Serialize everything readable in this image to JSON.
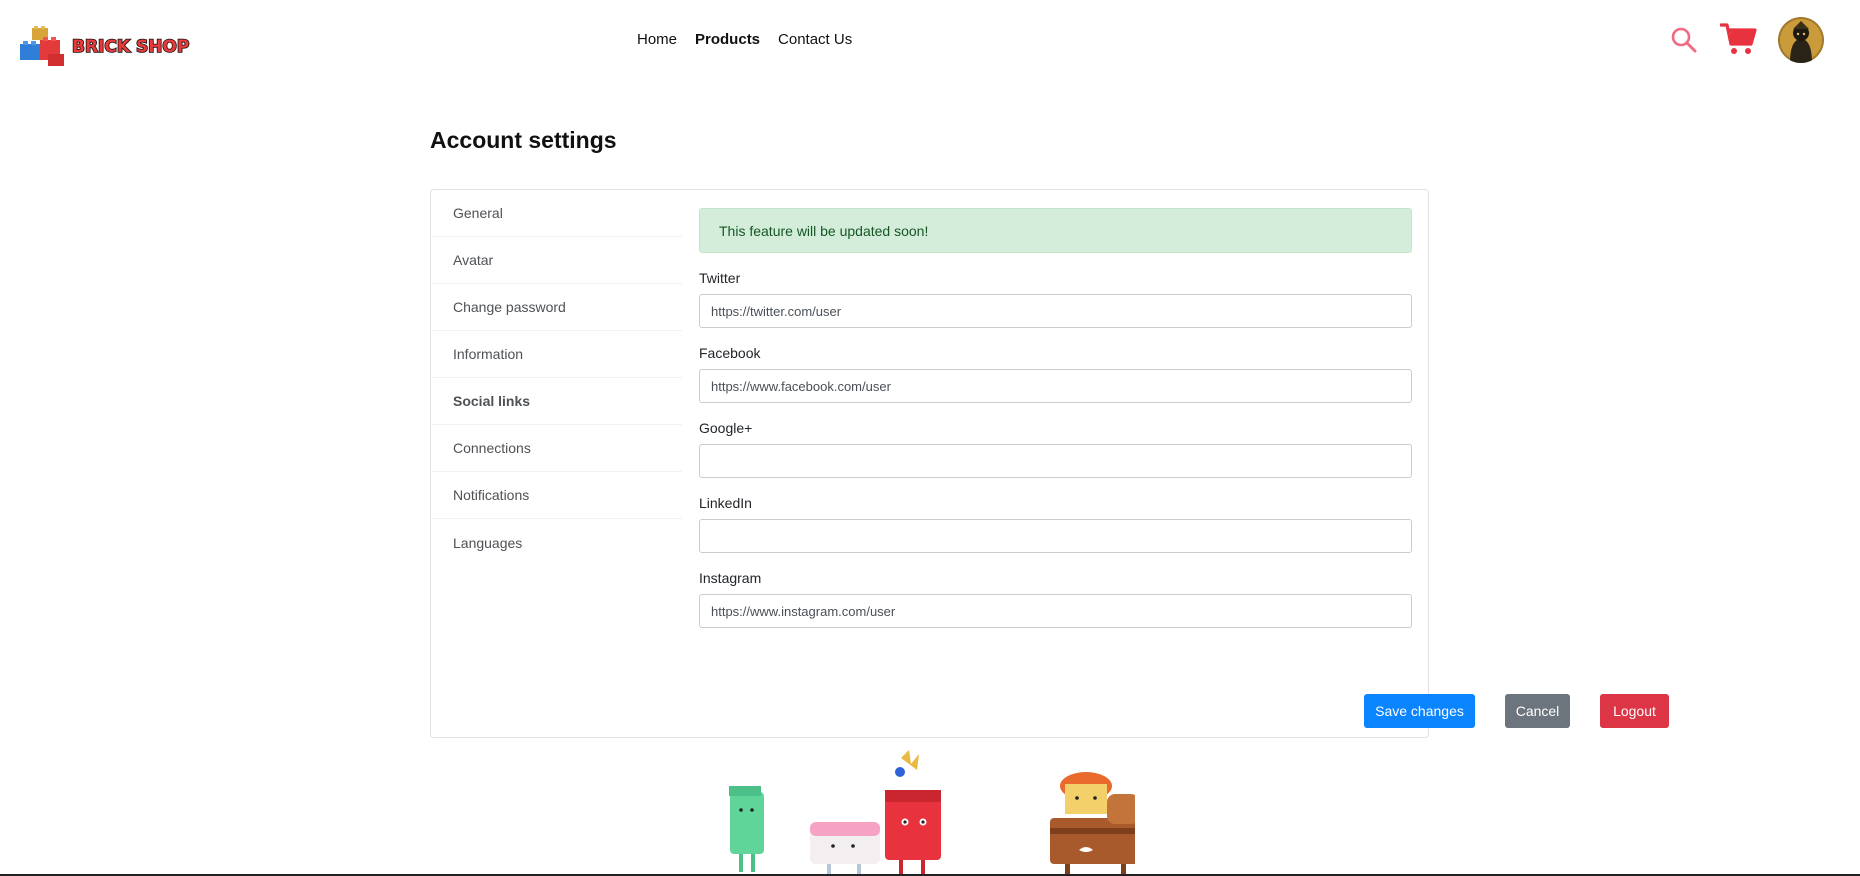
{
  "brand": {
    "name": "BRICK SHOP"
  },
  "nav": {
    "items": [
      {
        "label": "Home",
        "active": false
      },
      {
        "label": "Products",
        "active": true
      },
      {
        "label": "Contact Us",
        "active": false
      }
    ]
  },
  "header_icons": {
    "search": "search-icon",
    "cart": "cart-icon",
    "avatar": "user-avatar"
  },
  "page": {
    "title": "Account settings"
  },
  "sidebar": {
    "items": [
      {
        "label": "General"
      },
      {
        "label": "Avatar"
      },
      {
        "label": "Change password"
      },
      {
        "label": "Information"
      },
      {
        "label": "Social links",
        "active": true
      },
      {
        "label": "Connections"
      },
      {
        "label": "Notifications"
      },
      {
        "label": "Languages"
      }
    ]
  },
  "alert": {
    "text": "This feature will be updated soon!"
  },
  "form": {
    "fields": [
      {
        "label": "Twitter",
        "placeholder": "https://twitter.com/user"
      },
      {
        "label": "Facebook",
        "placeholder": "https://www.facebook.com/user"
      },
      {
        "label": "Google+",
        "placeholder": ""
      },
      {
        "label": "LinkedIn",
        "placeholder": ""
      },
      {
        "label": "Instagram",
        "placeholder": "https://www.instagram.com/user"
      }
    ]
  },
  "actions": {
    "save_label": "Save changes",
    "cancel_label": "Cancel",
    "logout_label": "Logout"
  },
  "colors": {
    "accent": "#0a84ff",
    "danger": "#dc3545",
    "secondary": "#6c757d",
    "alert_bg": "#d4edda",
    "cart_red": "#e8323e",
    "search_pink": "#f06b82"
  }
}
